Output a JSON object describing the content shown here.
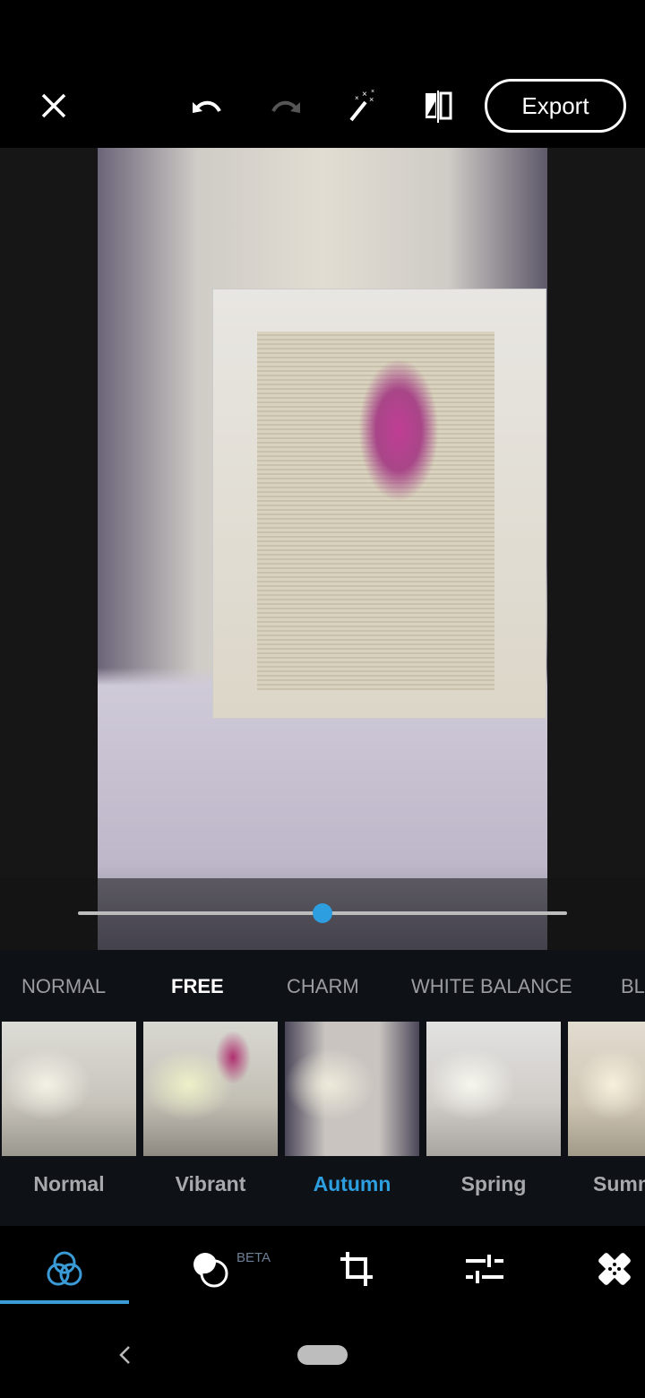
{
  "toolbar": {
    "close": "close-icon",
    "undo": "undo-icon",
    "redo": "redo-icon",
    "auto_fix": "magic-wand-icon",
    "compare": "compare-icon",
    "export_label": "Export"
  },
  "slider": {
    "value_fraction": 0.5,
    "accent": "#2d9ee0"
  },
  "categories": [
    {
      "label": "NORMAL",
      "selected": false
    },
    {
      "label": "FREE",
      "selected": true
    },
    {
      "label": "CHARM",
      "selected": false
    },
    {
      "label": "WHITE BALANCE",
      "selected": false
    },
    {
      "label": "BL",
      "selected": false
    }
  ],
  "presets": [
    {
      "label": "Normal",
      "selected": false
    },
    {
      "label": "Vibrant",
      "selected": false
    },
    {
      "label": "Autumn",
      "selected": true
    },
    {
      "label": "Spring",
      "selected": false
    },
    {
      "label": "Summ",
      "selected": false
    }
  ],
  "bottom_tabs": {
    "items": [
      "looks-icon",
      "blend-icon",
      "crop-icon",
      "adjustments-icon",
      "healing-icon"
    ],
    "beta_label": "BETA",
    "active": 0
  },
  "navbar": {
    "back": "back-chevron-icon",
    "home": "home-pill"
  },
  "colors": {
    "accent": "#2d9ee0",
    "selected_preset": "#2d9ee0"
  }
}
